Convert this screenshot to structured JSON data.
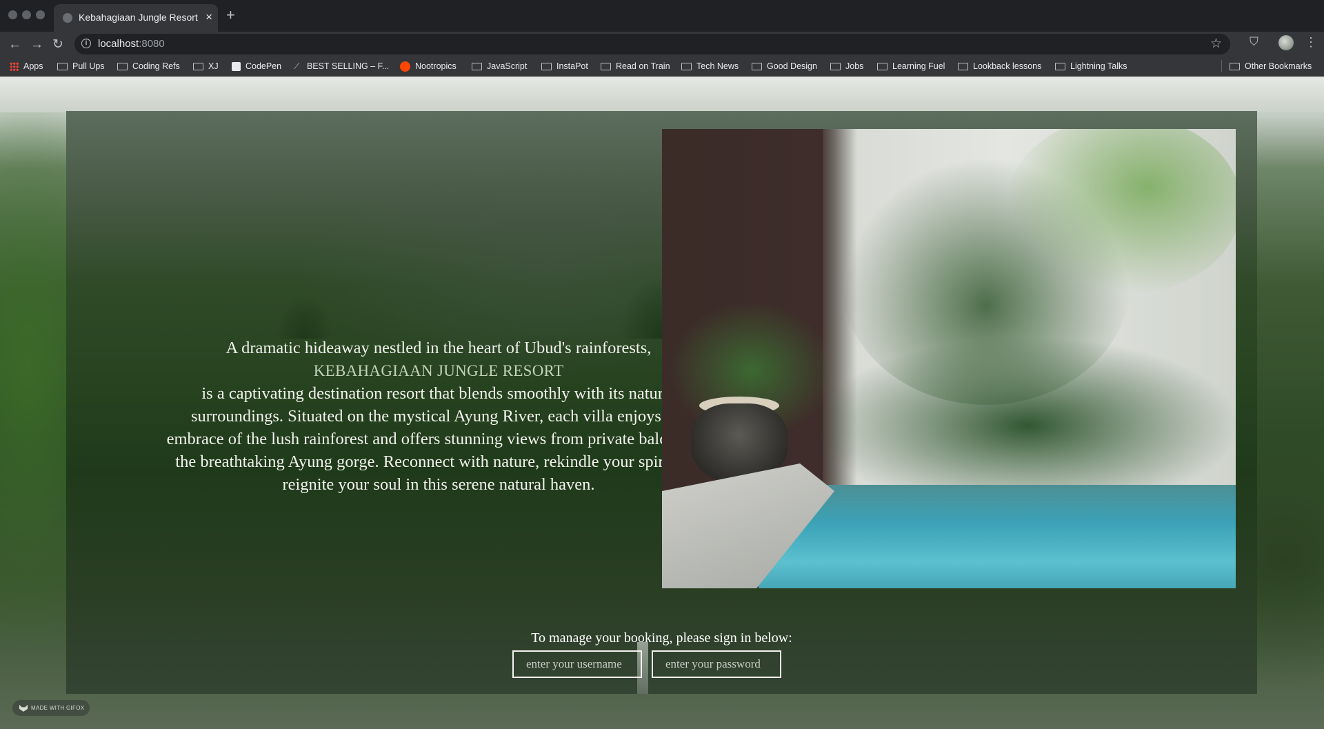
{
  "browser": {
    "tab_title": "Kebahagiaan Jungle Resort",
    "tab_close": "×",
    "new_tab": "+",
    "url_host": "localhost",
    "url_port": ":8080",
    "back": "←",
    "forward": "→",
    "reload": "↻",
    "star": "☆",
    "kebab": "⋮"
  },
  "bookmarks": [
    {
      "label": "Apps",
      "icon": "apps-grid-icon"
    },
    {
      "label": "Pull Ups",
      "icon": "folder-icon"
    },
    {
      "label": "Coding Refs",
      "icon": "folder-icon"
    },
    {
      "label": "XJ",
      "icon": "folder-icon"
    },
    {
      "label": "CodePen",
      "icon": "codepen-icon"
    },
    {
      "label": "BEST SELLING – F...",
      "icon": "feather-icon"
    },
    {
      "label": "Nootropics",
      "icon": "reddit-icon"
    },
    {
      "label": "JavaScript",
      "icon": "folder-icon"
    },
    {
      "label": "InstaPot",
      "icon": "folder-icon"
    },
    {
      "label": "Read on Train",
      "icon": "folder-icon"
    },
    {
      "label": "Tech News",
      "icon": "folder-icon"
    },
    {
      "label": "Good Design",
      "icon": "folder-icon"
    },
    {
      "label": "Jobs",
      "icon": "folder-icon"
    },
    {
      "label": "Learning Fuel",
      "icon": "folder-icon"
    },
    {
      "label": "Lookback lessons",
      "icon": "folder-icon"
    },
    {
      "label": "Lightning Talks",
      "icon": "folder-icon"
    }
  ],
  "other_bookmarks": "Other Bookmarks",
  "content": {
    "intro_before": "A dramatic hideaway nestled in the heart of Ubud's rainforests,",
    "resort_name": "KEBAHAGIAAN JUNGLE RESORT",
    "intro_after": "is a captivating destination resort that blends smoothly with its natural surroundings. Situated on the mystical Ayung River, each villa enjoys the embrace of the lush rainforest and offers stunning views from private balcony of the breathtaking Ayung gorge. Reconnect with nature, rekindle your spirit and reignite your soul in this serene natural haven.",
    "signin_label": "To manage your booking, please sign in below:",
    "username_placeholder": "enter your username",
    "password_placeholder": "enter your password"
  },
  "badge": "MADE WITH GIFOX",
  "colors": {
    "accent_name": "#c4d3b8",
    "chrome_dark": "#202124",
    "chrome": "#35363a"
  }
}
